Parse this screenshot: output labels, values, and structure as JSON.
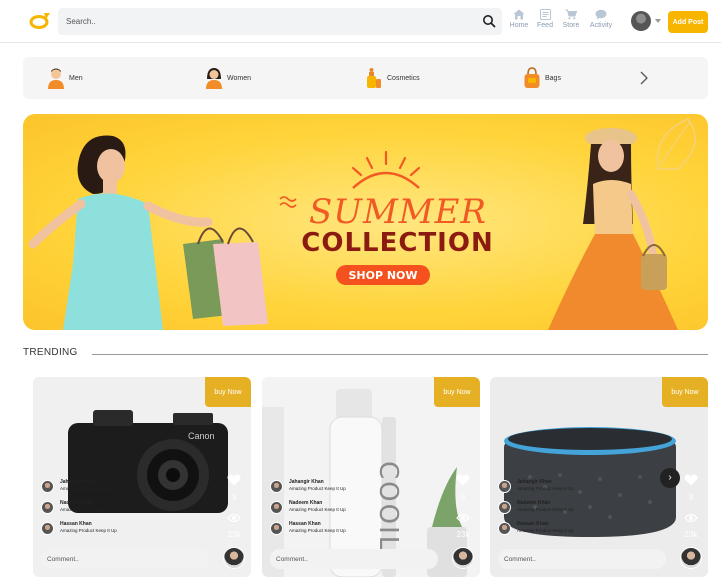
{
  "header": {
    "search_placeholder": "Search..",
    "nav": [
      {
        "label": "Home",
        "icon": "home-icon"
      },
      {
        "label": "Feed",
        "icon": "feed-icon"
      },
      {
        "label": "Store",
        "icon": "cart-icon"
      },
      {
        "label": "Activity",
        "icon": "chat-icon"
      }
    ],
    "add_post_label": "Add Post"
  },
  "categories": {
    "items": [
      {
        "label": "Men",
        "icon": "man-icon"
      },
      {
        "label": "Women",
        "icon": "woman-icon"
      },
      {
        "label": "Cosmetics",
        "icon": "cosmetics-icon"
      },
      {
        "label": "Bags",
        "icon": "bag-icon"
      }
    ]
  },
  "banner": {
    "line1": "SUMMER",
    "line2": "COLLECTION",
    "cta": "SHOP NOW"
  },
  "trending": {
    "title": "TRENDING",
    "cards": [
      {
        "buy_label": "buy Now",
        "product": "camera",
        "users": [
          {
            "name": "Jahangir Khan",
            "text": "Amazing Product Keep It Up"
          },
          {
            "name": "Nadeem Khan",
            "text": "Amazing Product Keep It Up"
          },
          {
            "name": "Hassan Khan",
            "text": "Amazing Product Keep It Up"
          }
        ],
        "likes": "3",
        "views": "23k",
        "comment_placeholder": "Comment.."
      },
      {
        "buy_label": "buy Now",
        "product": "cosmetic bottle",
        "users": [
          {
            "name": "Jahangir Khan",
            "text": "Amazing Product Keep It Up"
          },
          {
            "name": "Nadeem Khan",
            "text": "Amazing Product Keep It Up"
          },
          {
            "name": "Hassan Khan",
            "text": "Amazing Product Keep It Up"
          }
        ],
        "likes": "3",
        "views": "23k",
        "comment_placeholder": "Comment.."
      },
      {
        "buy_label": "buy Now",
        "product": "smart speaker",
        "users": [
          {
            "name": "Jahangir Khan",
            "text": "Amazing Product Keep It Up"
          },
          {
            "name": "Nadeem Khan",
            "text": "Amazing Product Keep It Up"
          },
          {
            "name": "Hassan Khan",
            "text": "Amazing Product Keep It Up"
          }
        ],
        "likes": "3",
        "views": "23k",
        "comment_placeholder": "Comment.."
      }
    ]
  },
  "colors": {
    "accent": "#f7b500",
    "buy_now": "#e6b024",
    "banner_bg": "#ffd43a",
    "banner_title": "#f15a24",
    "banner_subtitle": "#8b1a10"
  }
}
